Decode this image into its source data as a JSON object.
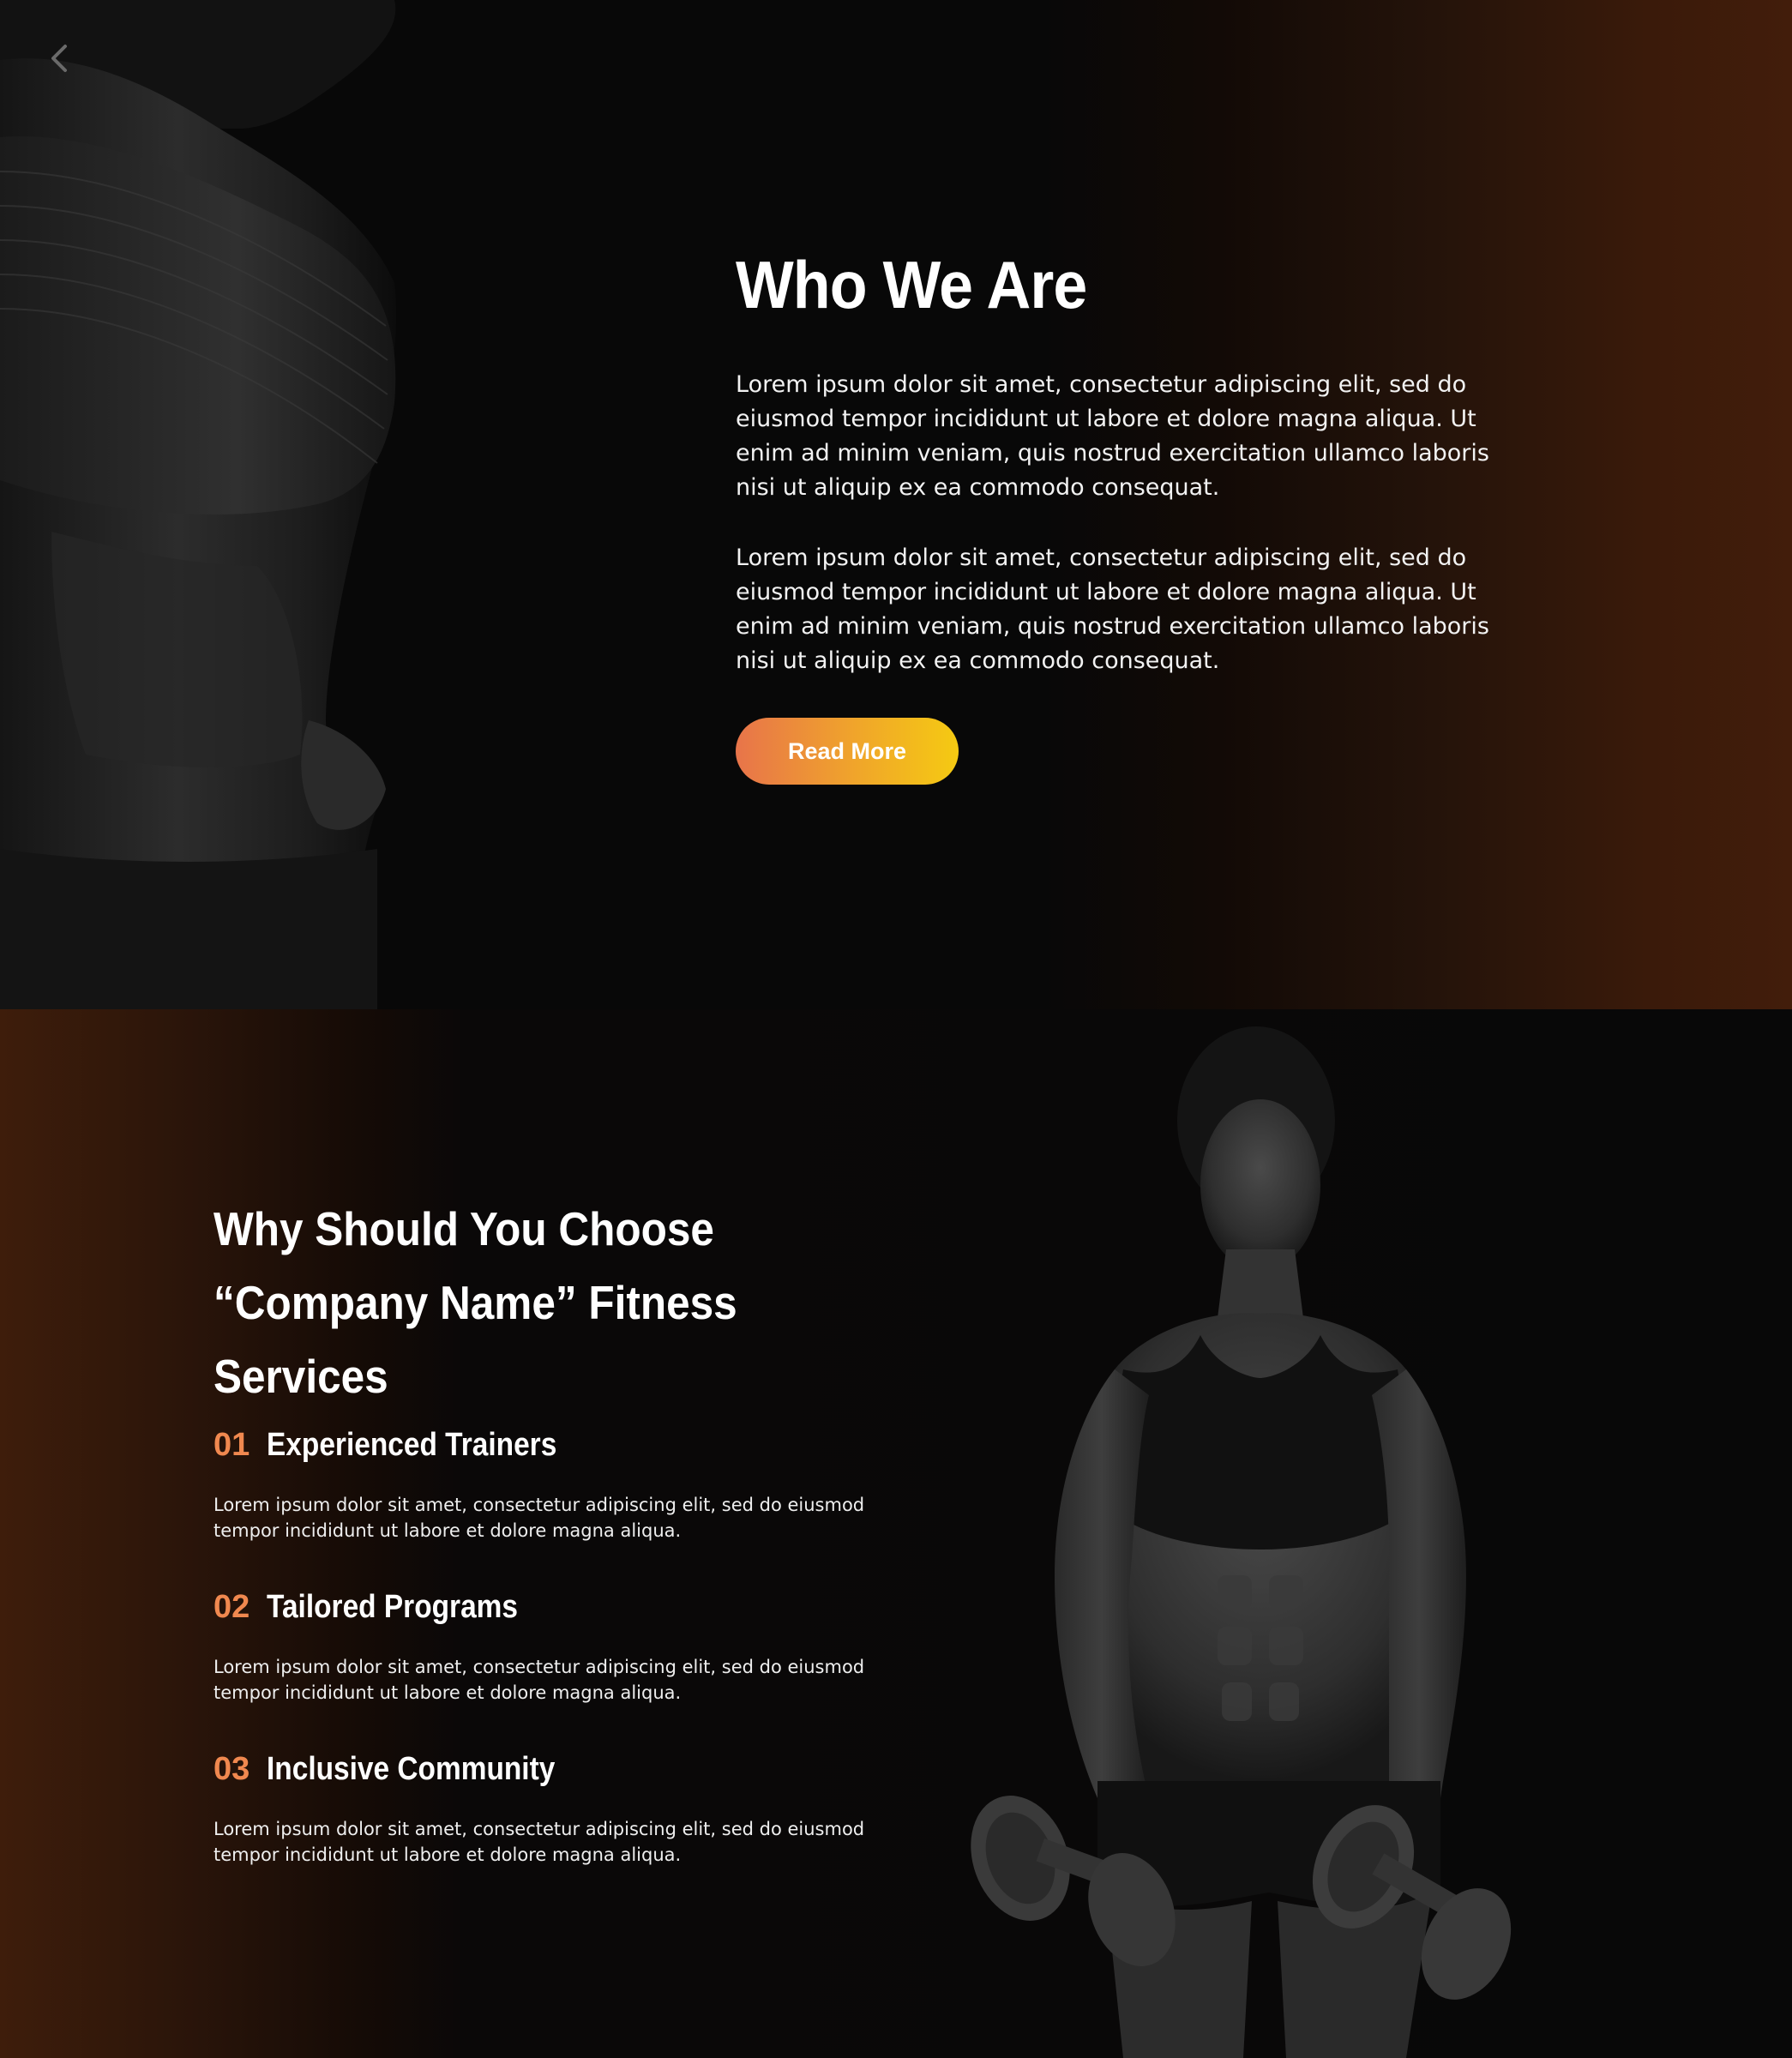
{
  "who_we_are": {
    "title": "Who We Are",
    "paragraph_1": "Lorem ipsum dolor sit amet, consectetur adipiscing elit, sed do eiusmod tempor incididunt ut labore et dolore magna aliqua. Ut enim ad minim veniam, quis nostrud exercitation ullamco laboris nisi ut aliquip ex ea commodo consequat.",
    "paragraph_2": "Lorem ipsum dolor sit amet, consectetur adipiscing elit, sed do eiusmod tempor incididunt ut labore et dolore magna aliqua. Ut enim ad minim veniam, quis nostrud exercitation ullamco laboris nisi ut aliquip ex ea commodo consequat.",
    "button_label": "Read More",
    "image_icon": "fitness-woman-torso-photo",
    "nav_icon": "chevron-left-icon"
  },
  "why_choose": {
    "title": "Why Should You Choose “Company Name” Fitness Services",
    "image_icon": "fitness-woman-dumbbells-photo",
    "features": [
      {
        "number": "01",
        "title": "Experienced Trainers",
        "description": "Lorem ipsum dolor sit amet, consectetur adipiscing elit, sed do eiusmod tempor incididunt ut labore et dolore magna aliqua."
      },
      {
        "number": "02",
        "title": "Tailored Programs",
        "description": "Lorem ipsum dolor sit amet, consectetur adipiscing elit, sed do eiusmod tempor incididunt ut labore et dolore magna aliqua."
      },
      {
        "number": "03",
        "title": "Inclusive Community",
        "description": "Lorem ipsum dolor sit amet, consectetur adipiscing elit, sed do eiusmod tempor incididunt ut labore et dolore magna aliqua."
      }
    ]
  },
  "colors": {
    "background": "#080808",
    "accent_brown": "#421d0b",
    "number_orange": "#f0884f",
    "button_gradient_start": "#e8744a",
    "button_gradient_end": "#f5ca12",
    "text": "#ffffff"
  }
}
